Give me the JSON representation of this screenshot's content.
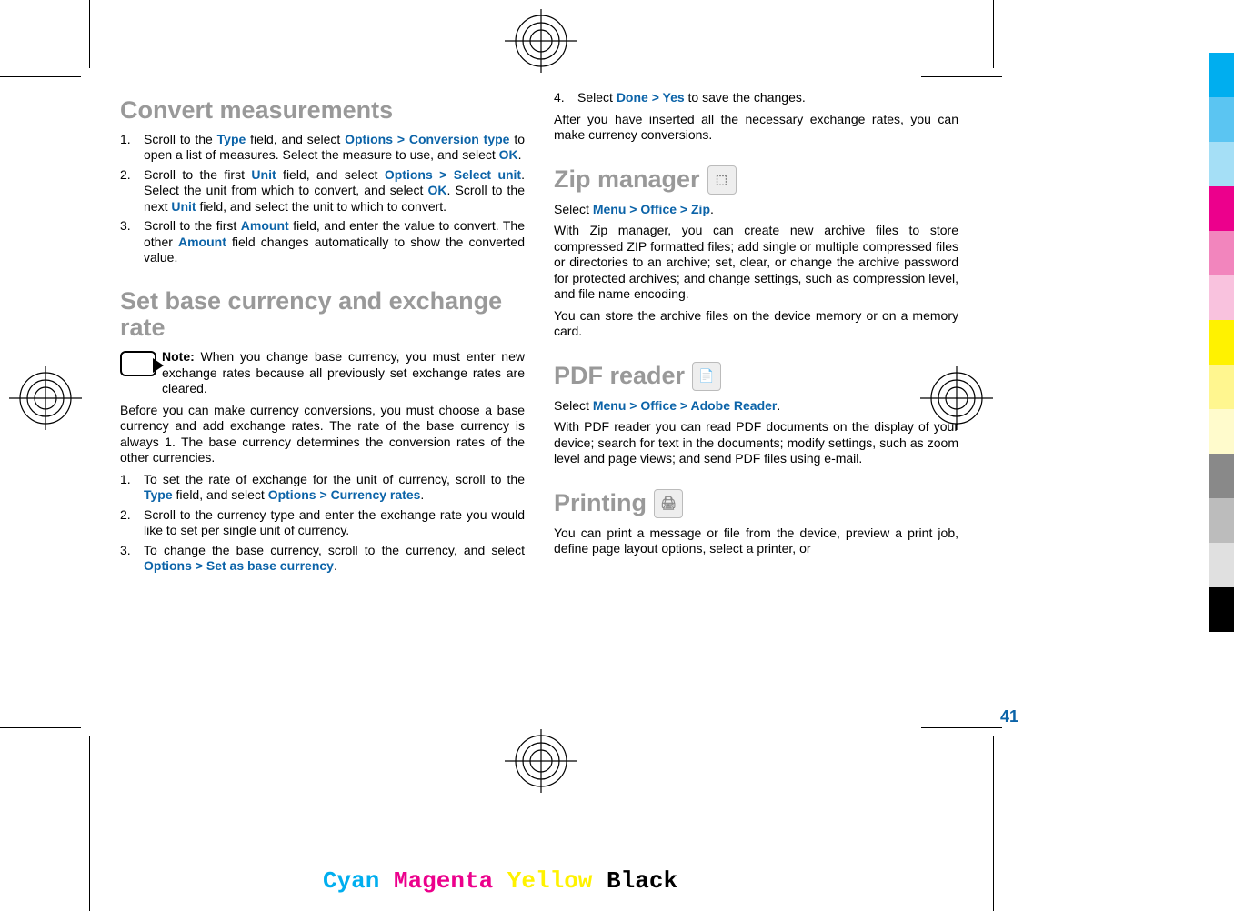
{
  "page_number": "41",
  "headings": {
    "convert": "Convert measurements",
    "setbase": "Set base currency and exchange rate",
    "zip": "Zip manager",
    "pdf": "PDF reader",
    "printing": "Printing"
  },
  "ui": {
    "Type": "Type",
    "Options": "Options",
    "ConversionType": "Conversion type",
    "OK": "OK",
    "Unit": "Unit",
    "SelectUnit": "Select unit",
    "Amount": "Amount",
    "CurrencyRates": "Currency rates",
    "SetAsBase": "Set as base currency",
    "Done": "Done",
    "Yes": "Yes",
    "Menu": "Menu",
    "Office": "Office",
    "Zip": "Zip",
    "AdobeReader": "Adobe Reader"
  },
  "txt": {
    "c1a": "Scroll to the ",
    "c1b": " field, and select ",
    "c1c": " to open a list of measures. Select the measure to use, and select ",
    "c2a": "Scroll to the first ",
    "c2b": " field, and select ",
    "c2c": ". Select the unit from which to convert, and select ",
    "c2d": ". Scroll to the next ",
    "c2e": " field, and select the unit to which to convert.",
    "c3a": "Scroll to the first ",
    "c3b": " field, and enter the value to convert. The other ",
    "c3c": " field changes automatically to show the converted value.",
    "noteLabel": "Note: ",
    "noteBody": "When you change base currency, you must enter new exchange rates because all previously set exchange rates are cleared.",
    "b1": "Before you can make currency conversions, you must choose a base currency and add exchange rates. The rate of the base currency is always 1. The base currency determines the conversion rates of the other currencies.",
    "r1a": "To set the rate of exchange for the unit of currency, scroll to the ",
    "r1b": " field, and select ",
    "r2": "Scroll to the currency type and enter the exchange rate you would like to set per single unit of currency.",
    "r3a": "To change the base currency, scroll to the currency, and select ",
    "r4a": "Select ",
    "r4b": " to save the changes.",
    "afterRates": "After you have inserted all the necessary exchange rates, you can make currency conversions.",
    "zipSelect": "Select ",
    "zipBody": "With Zip manager, you can create new archive files to store compressed ZIP formatted files; add single or multiple compressed files or directories to an archive; set, clear, or change the archive password for protected archives; and change settings, such as compression level, and file name encoding.",
    "zipStore": "You can store the archive files on the device memory or on a memory card.",
    "pdfSelect": "Select ",
    "pdfBody": "With PDF reader you can read PDF documents on the display of your device; search for text in the documents; modify settings, such as zoom level and page views; and send PDF files using e-mail.",
    "printBody": "You can print a message or file from the device, preview a print job, define page layout options, select a printer, or"
  },
  "colorbar": [
    "#00aeef",
    "#5bc5f2",
    "#a5dff6",
    "#ec008c",
    "#f285bd",
    "#f9c2de",
    "#fff200",
    "#fff68f",
    "#fffbcc",
    "#898989",
    "#bcbcbc",
    "#e0e0e0",
    "#000000"
  ],
  "labels": {
    "cyan": "Cyan",
    "magenta": "Magenta",
    "yellow": "Yellow",
    "black": "Black"
  }
}
